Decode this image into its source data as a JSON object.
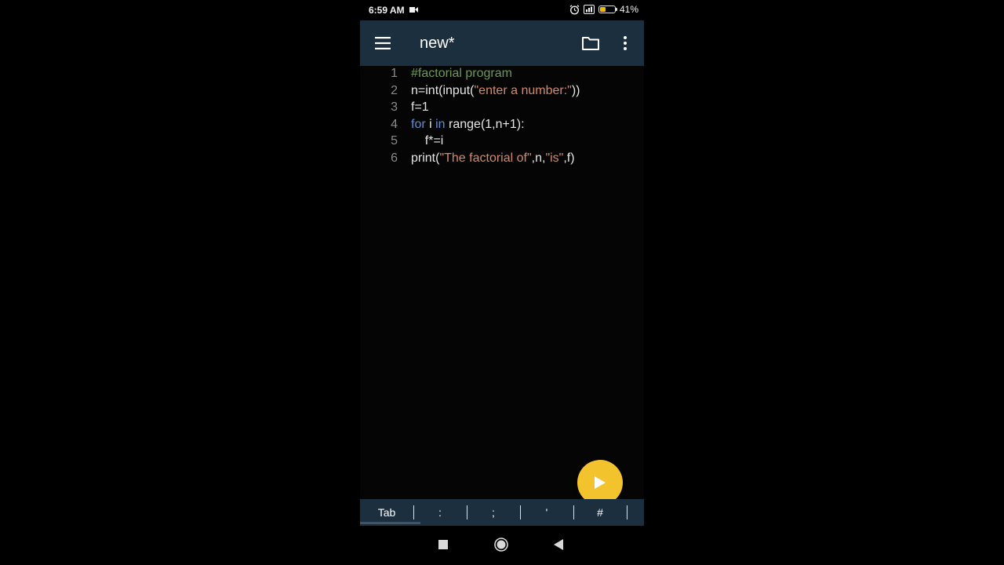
{
  "status_bar": {
    "time": "6:59 AM",
    "battery_label": "41%",
    "battery_level": 0.41,
    "icons": [
      "video-camera-icon",
      "alarm-icon",
      "signal-icon",
      "battery-icon"
    ]
  },
  "app_bar": {
    "title": "new*",
    "icons": [
      "menu-icon",
      "folder-icon",
      "more-vert-icon"
    ]
  },
  "editor": {
    "lines": [
      {
        "num": "1",
        "tokens": [
          {
            "t": "#factorial program",
            "k": "comment"
          }
        ]
      },
      {
        "num": "2",
        "tokens": [
          {
            "t": "n=int(input(",
            "k": "plain"
          },
          {
            "t": "\"enter a number:\"",
            "k": "string"
          },
          {
            "t": "))",
            "k": "plain"
          }
        ]
      },
      {
        "num": "3",
        "tokens": [
          {
            "t": "f=1",
            "k": "plain"
          }
        ]
      },
      {
        "num": "4",
        "tokens": [
          {
            "t": "for",
            "k": "keyword"
          },
          {
            "t": " i ",
            "k": "plain"
          },
          {
            "t": "in",
            "k": "keyword"
          },
          {
            "t": " range(1,n+1):",
            "k": "plain"
          }
        ]
      },
      {
        "num": "5",
        "tokens": [
          {
            "t": "    f*=i",
            "k": "plain"
          }
        ]
      },
      {
        "num": "6",
        "tokens": [
          {
            "t": "print(",
            "k": "plain"
          },
          {
            "t": "\"The factorial of\"",
            "k": "string"
          },
          {
            "t": ",n,",
            "k": "plain"
          },
          {
            "t": "\"is\"",
            "k": "string"
          },
          {
            "t": ",f)",
            "k": "plain"
          }
        ]
      }
    ]
  },
  "run_button": {
    "icon": "play-icon",
    "color": "#f3c32e"
  },
  "symbol_bar": {
    "keys": [
      "Tab",
      ":",
      ";",
      "'",
      "#"
    ]
  },
  "nav_bar": {
    "icons": [
      "square-icon",
      "circle-icon",
      "back-triangle-icon"
    ]
  },
  "colors": {
    "app_bar": "#1c2f3e",
    "comment": "#6a9955",
    "keyword": "#5a8fd6",
    "string": "#d38a6a"
  }
}
